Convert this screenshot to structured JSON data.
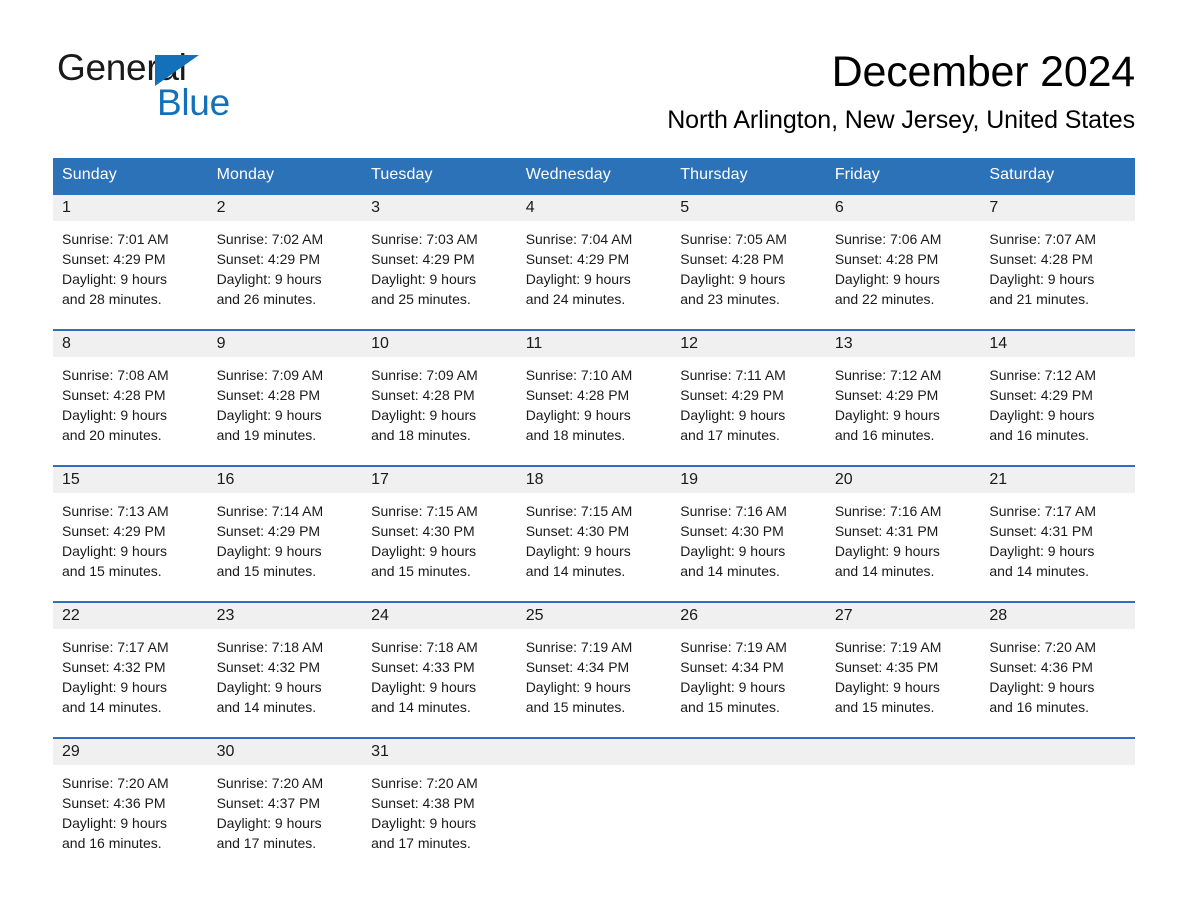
{
  "brand": {
    "name_part1": "General",
    "name_part2": "Blue",
    "triangle_color": "#1470b8",
    "accent_color": "#2c72b8"
  },
  "header": {
    "month_title": "December 2024",
    "location": "North Arlington, New Jersey, United States"
  },
  "calendar": {
    "weekday_headers": [
      "Sunday",
      "Monday",
      "Tuesday",
      "Wednesday",
      "Thursday",
      "Friday",
      "Saturday"
    ],
    "weeks": [
      [
        {
          "day": "1",
          "sunrise": "Sunrise: 7:01 AM",
          "sunset": "Sunset: 4:29 PM",
          "daylight_line1": "Daylight: 9 hours",
          "daylight_line2": "and 28 minutes."
        },
        {
          "day": "2",
          "sunrise": "Sunrise: 7:02 AM",
          "sunset": "Sunset: 4:29 PM",
          "daylight_line1": "Daylight: 9 hours",
          "daylight_line2": "and 26 minutes."
        },
        {
          "day": "3",
          "sunrise": "Sunrise: 7:03 AM",
          "sunset": "Sunset: 4:29 PM",
          "daylight_line1": "Daylight: 9 hours",
          "daylight_line2": "and 25 minutes."
        },
        {
          "day": "4",
          "sunrise": "Sunrise: 7:04 AM",
          "sunset": "Sunset: 4:29 PM",
          "daylight_line1": "Daylight: 9 hours",
          "daylight_line2": "and 24 minutes."
        },
        {
          "day": "5",
          "sunrise": "Sunrise: 7:05 AM",
          "sunset": "Sunset: 4:28 PM",
          "daylight_line1": "Daylight: 9 hours",
          "daylight_line2": "and 23 minutes."
        },
        {
          "day": "6",
          "sunrise": "Sunrise: 7:06 AM",
          "sunset": "Sunset: 4:28 PM",
          "daylight_line1": "Daylight: 9 hours",
          "daylight_line2": "and 22 minutes."
        },
        {
          "day": "7",
          "sunrise": "Sunrise: 7:07 AM",
          "sunset": "Sunset: 4:28 PM",
          "daylight_line1": "Daylight: 9 hours",
          "daylight_line2": "and 21 minutes."
        }
      ],
      [
        {
          "day": "8",
          "sunrise": "Sunrise: 7:08 AM",
          "sunset": "Sunset: 4:28 PM",
          "daylight_line1": "Daylight: 9 hours",
          "daylight_line2": "and 20 minutes."
        },
        {
          "day": "9",
          "sunrise": "Sunrise: 7:09 AM",
          "sunset": "Sunset: 4:28 PM",
          "daylight_line1": "Daylight: 9 hours",
          "daylight_line2": "and 19 minutes."
        },
        {
          "day": "10",
          "sunrise": "Sunrise: 7:09 AM",
          "sunset": "Sunset: 4:28 PM",
          "daylight_line1": "Daylight: 9 hours",
          "daylight_line2": "and 18 minutes."
        },
        {
          "day": "11",
          "sunrise": "Sunrise: 7:10 AM",
          "sunset": "Sunset: 4:28 PM",
          "daylight_line1": "Daylight: 9 hours",
          "daylight_line2": "and 18 minutes."
        },
        {
          "day": "12",
          "sunrise": "Sunrise: 7:11 AM",
          "sunset": "Sunset: 4:29 PM",
          "daylight_line1": "Daylight: 9 hours",
          "daylight_line2": "and 17 minutes."
        },
        {
          "day": "13",
          "sunrise": "Sunrise: 7:12 AM",
          "sunset": "Sunset: 4:29 PM",
          "daylight_line1": "Daylight: 9 hours",
          "daylight_line2": "and 16 minutes."
        },
        {
          "day": "14",
          "sunrise": "Sunrise: 7:12 AM",
          "sunset": "Sunset: 4:29 PM",
          "daylight_line1": "Daylight: 9 hours",
          "daylight_line2": "and 16 minutes."
        }
      ],
      [
        {
          "day": "15",
          "sunrise": "Sunrise: 7:13 AM",
          "sunset": "Sunset: 4:29 PM",
          "daylight_line1": "Daylight: 9 hours",
          "daylight_line2": "and 15 minutes."
        },
        {
          "day": "16",
          "sunrise": "Sunrise: 7:14 AM",
          "sunset": "Sunset: 4:29 PM",
          "daylight_line1": "Daylight: 9 hours",
          "daylight_line2": "and 15 minutes."
        },
        {
          "day": "17",
          "sunrise": "Sunrise: 7:15 AM",
          "sunset": "Sunset: 4:30 PM",
          "daylight_line1": "Daylight: 9 hours",
          "daylight_line2": "and 15 minutes."
        },
        {
          "day": "18",
          "sunrise": "Sunrise: 7:15 AM",
          "sunset": "Sunset: 4:30 PM",
          "daylight_line1": "Daylight: 9 hours",
          "daylight_line2": "and 14 minutes."
        },
        {
          "day": "19",
          "sunrise": "Sunrise: 7:16 AM",
          "sunset": "Sunset: 4:30 PM",
          "daylight_line1": "Daylight: 9 hours",
          "daylight_line2": "and 14 minutes."
        },
        {
          "day": "20",
          "sunrise": "Sunrise: 7:16 AM",
          "sunset": "Sunset: 4:31 PM",
          "daylight_line1": "Daylight: 9 hours",
          "daylight_line2": "and 14 minutes."
        },
        {
          "day": "21",
          "sunrise": "Sunrise: 7:17 AM",
          "sunset": "Sunset: 4:31 PM",
          "daylight_line1": "Daylight: 9 hours",
          "daylight_line2": "and 14 minutes."
        }
      ],
      [
        {
          "day": "22",
          "sunrise": "Sunrise: 7:17 AM",
          "sunset": "Sunset: 4:32 PM",
          "daylight_line1": "Daylight: 9 hours",
          "daylight_line2": "and 14 minutes."
        },
        {
          "day": "23",
          "sunrise": "Sunrise: 7:18 AM",
          "sunset": "Sunset: 4:32 PM",
          "daylight_line1": "Daylight: 9 hours",
          "daylight_line2": "and 14 minutes."
        },
        {
          "day": "24",
          "sunrise": "Sunrise: 7:18 AM",
          "sunset": "Sunset: 4:33 PM",
          "daylight_line1": "Daylight: 9 hours",
          "daylight_line2": "and 14 minutes."
        },
        {
          "day": "25",
          "sunrise": "Sunrise: 7:19 AM",
          "sunset": "Sunset: 4:34 PM",
          "daylight_line1": "Daylight: 9 hours",
          "daylight_line2": "and 15 minutes."
        },
        {
          "day": "26",
          "sunrise": "Sunrise: 7:19 AM",
          "sunset": "Sunset: 4:34 PM",
          "daylight_line1": "Daylight: 9 hours",
          "daylight_line2": "and 15 minutes."
        },
        {
          "day": "27",
          "sunrise": "Sunrise: 7:19 AM",
          "sunset": "Sunset: 4:35 PM",
          "daylight_line1": "Daylight: 9 hours",
          "daylight_line2": "and 15 minutes."
        },
        {
          "day": "28",
          "sunrise": "Sunrise: 7:20 AM",
          "sunset": "Sunset: 4:36 PM",
          "daylight_line1": "Daylight: 9 hours",
          "daylight_line2": "and 16 minutes."
        }
      ],
      [
        {
          "day": "29",
          "sunrise": "Sunrise: 7:20 AM",
          "sunset": "Sunset: 4:36 PM",
          "daylight_line1": "Daylight: 9 hours",
          "daylight_line2": "and 16 minutes."
        },
        {
          "day": "30",
          "sunrise": "Sunrise: 7:20 AM",
          "sunset": "Sunset: 4:37 PM",
          "daylight_line1": "Daylight: 9 hours",
          "daylight_line2": "and 17 minutes."
        },
        {
          "day": "31",
          "sunrise": "Sunrise: 7:20 AM",
          "sunset": "Sunset: 4:38 PM",
          "daylight_line1": "Daylight: 9 hours",
          "daylight_line2": "and 17 minutes."
        },
        {
          "day": "",
          "sunrise": "",
          "sunset": "",
          "daylight_line1": "",
          "daylight_line2": ""
        },
        {
          "day": "",
          "sunrise": "",
          "sunset": "",
          "daylight_line1": "",
          "daylight_line2": ""
        },
        {
          "day": "",
          "sunrise": "",
          "sunset": "",
          "daylight_line1": "",
          "daylight_line2": ""
        },
        {
          "day": "",
          "sunrise": "",
          "sunset": "",
          "daylight_line1": "",
          "daylight_line2": ""
        }
      ]
    ]
  }
}
